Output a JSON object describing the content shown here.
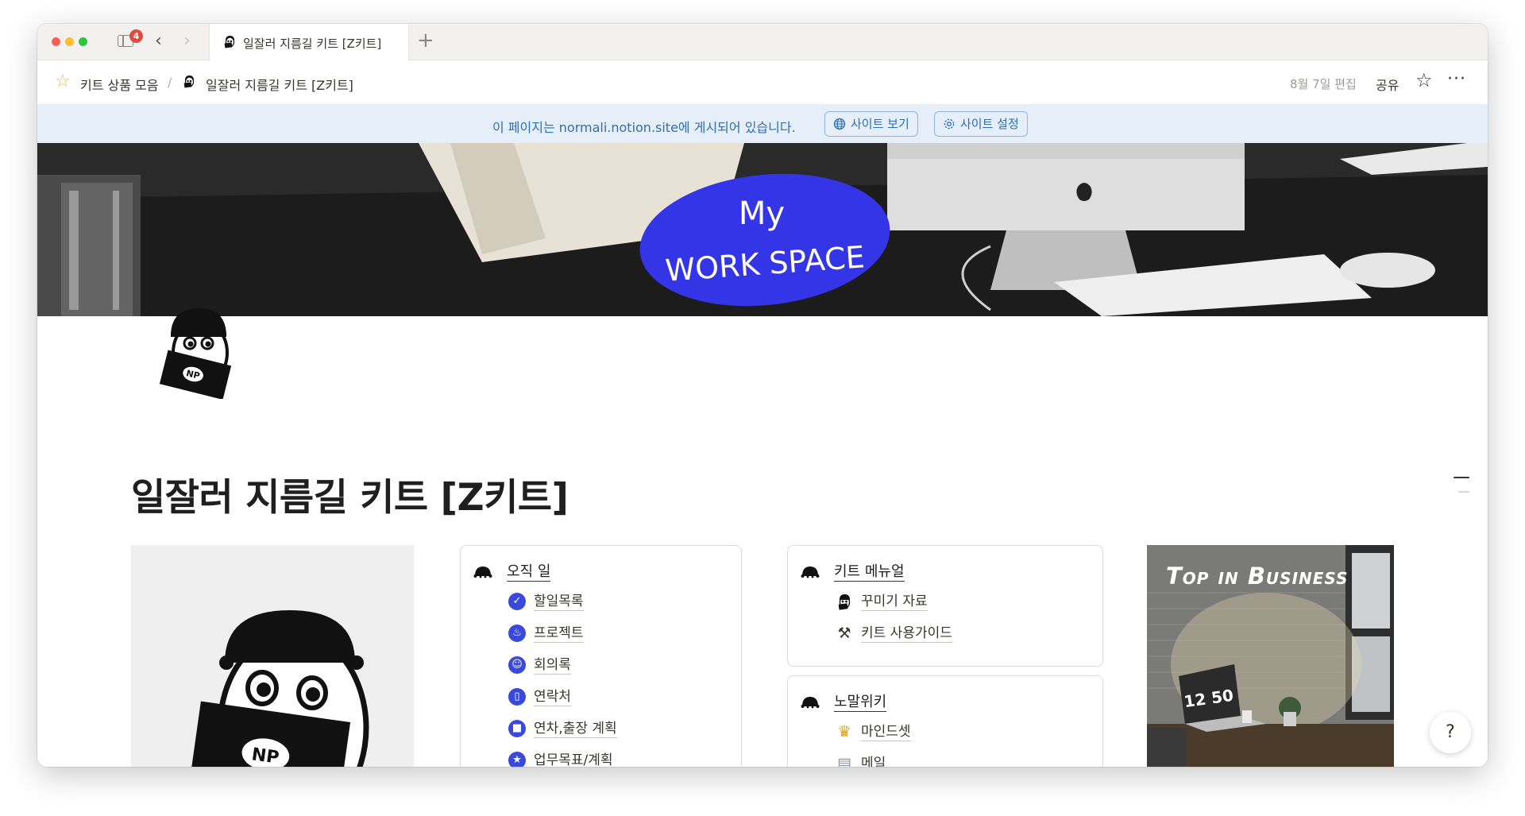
{
  "tabbar": {
    "badge_count": "4",
    "back_icon": "‹",
    "forward_icon": "›",
    "active_tab_label": "일잘러 지름길 키트 [Z키트]",
    "new_tab_icon": "+"
  },
  "topbar": {
    "breadcrumb": [
      {
        "icon": "star-emoji",
        "label": "키트 상품 모음"
      },
      {
        "icon": "np-character-icon",
        "label": "일잘러 지름길 키트 [Z키트]"
      }
    ],
    "separator": "/",
    "edited": "8월 7일 편집",
    "share": "공유",
    "more": "···"
  },
  "publish_banner": {
    "text": "이 페이지는 normali.notion.site에 게시되어 있습니다.",
    "view_site": "사이트 보기",
    "site_settings": "사이트 설정",
    "color": "#2a6fb7"
  },
  "cover": {
    "logo_line1": "My",
    "logo_line2": "WORK SPACE",
    "logo_color": "#3535e8"
  },
  "page": {
    "title": "일잘러 지름길 키트 [Z키트]"
  },
  "columns": {
    "work": {
      "heading": "오직 일",
      "items": [
        {
          "icon": "check-circle-icon",
          "glyph": "✓",
          "label": "할일목록"
        },
        {
          "icon": "fire-circle-icon",
          "glyph": "♨",
          "label": "프로젝트"
        },
        {
          "icon": "smile-circle-icon",
          "glyph": "☺",
          "label": "회의록"
        },
        {
          "icon": "phone-circle-icon",
          "glyph": "▯",
          "label": "연락처"
        },
        {
          "icon": "calendar-circle-icon",
          "glyph": "■",
          "label": "연차,출장 계획"
        },
        {
          "icon": "star-circle-icon",
          "glyph": "★",
          "label": "업무목표/계획"
        }
      ]
    },
    "manual": {
      "heading": "키트 메뉴얼",
      "items": [
        {
          "icon": "np-character-icon",
          "glyph": "",
          "label": "꾸미기 자료"
        },
        {
          "icon": "tools-icon",
          "glyph": "⚒",
          "label": "키트 사용가이드"
        }
      ]
    },
    "wiki": {
      "heading": "노말위키",
      "items": [
        {
          "icon": "trophy-icon",
          "glyph": "🏆",
          "label": "마인드셋"
        },
        {
          "icon": "newspaper-icon",
          "glyph": "▤",
          "label": "메일"
        }
      ]
    }
  },
  "right_image": {
    "caption": "Top in Business",
    "clock": "12 50"
  },
  "help_button": "?"
}
